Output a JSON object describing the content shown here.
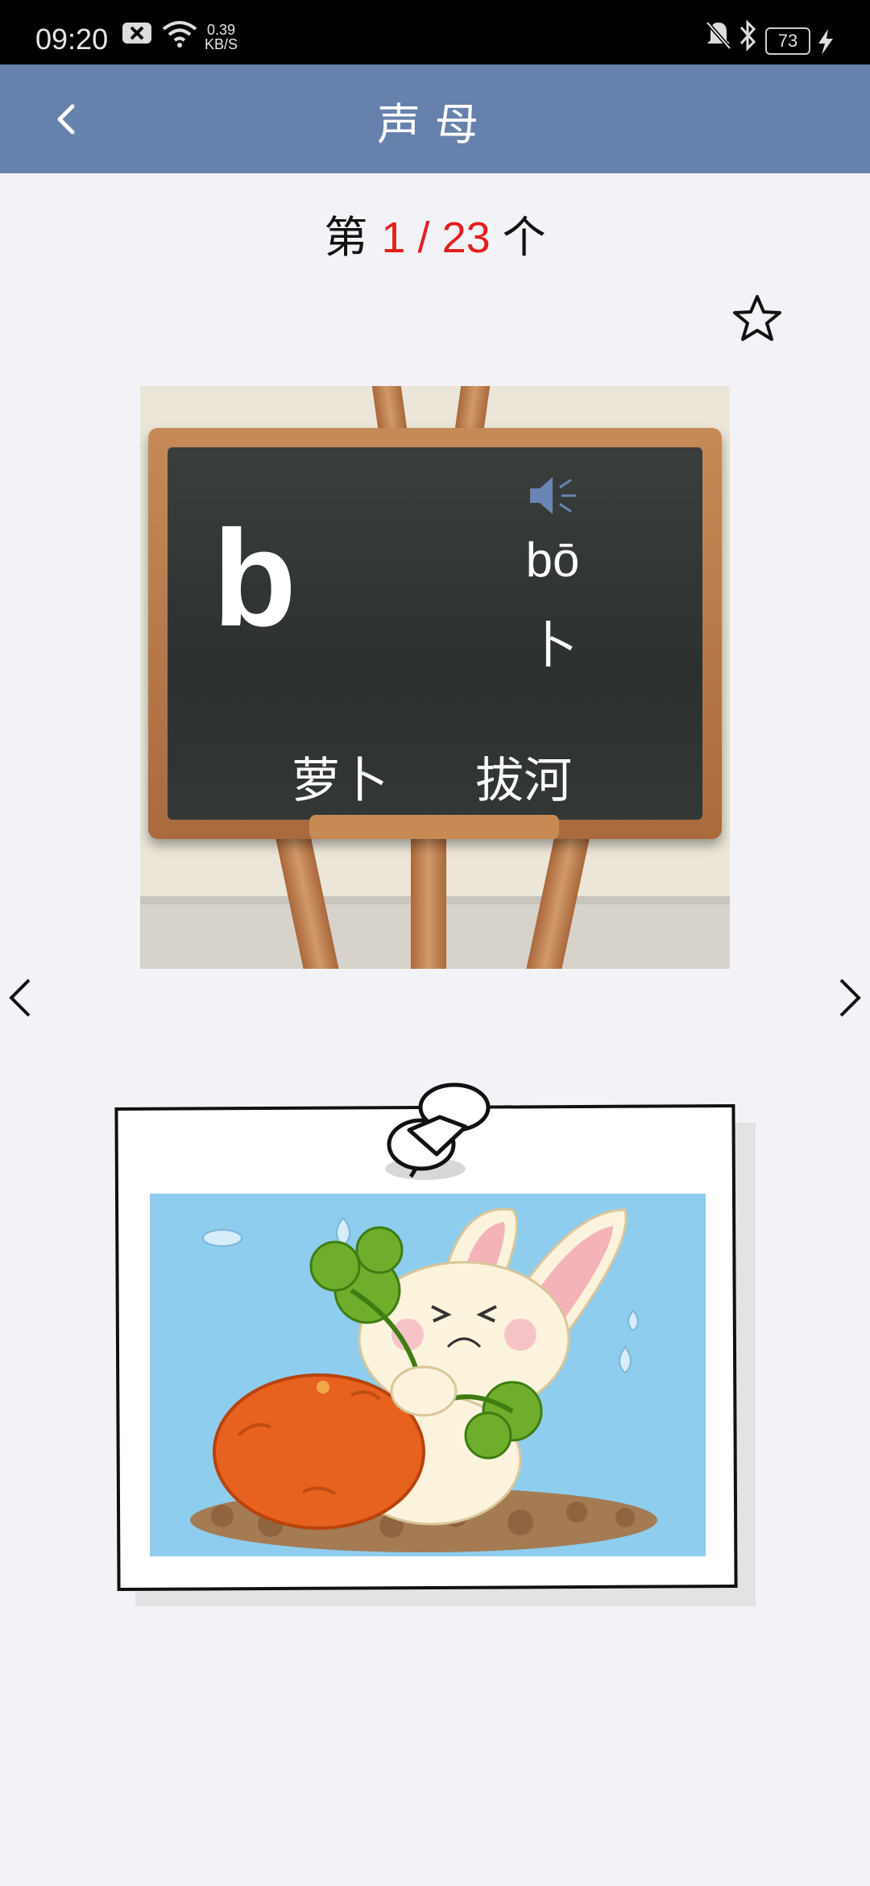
{
  "status_bar": {
    "time": "09:20",
    "speed_value": "0.39",
    "speed_unit": "KB/S",
    "battery": "73",
    "icons": [
      "notification-x-icon",
      "wifi-icon",
      "mute-bell-icon",
      "bluetooth-icon",
      "battery-icon",
      "charging-bolt-icon"
    ]
  },
  "header": {
    "title": "声母",
    "back_icon": "chevron-left-icon"
  },
  "counter": {
    "prefix": "第",
    "current": "1",
    "separator": " / ",
    "total": "23",
    "suffix": "个"
  },
  "card": {
    "letter": "b",
    "pinyin": "bō",
    "character": "卜",
    "word1": "萝卜",
    "word2": "拔河",
    "speaker_icon": "speaker-icon",
    "favorite_icon": "star-outline-icon"
  },
  "navigation": {
    "prev_icon": "chevron-left-icon",
    "next_icon": "chevron-right-icon"
  },
  "colors": {
    "header_bg": "#6681ac",
    "counter_accent": "#e31f1f",
    "speaker": "#6a85b5"
  }
}
